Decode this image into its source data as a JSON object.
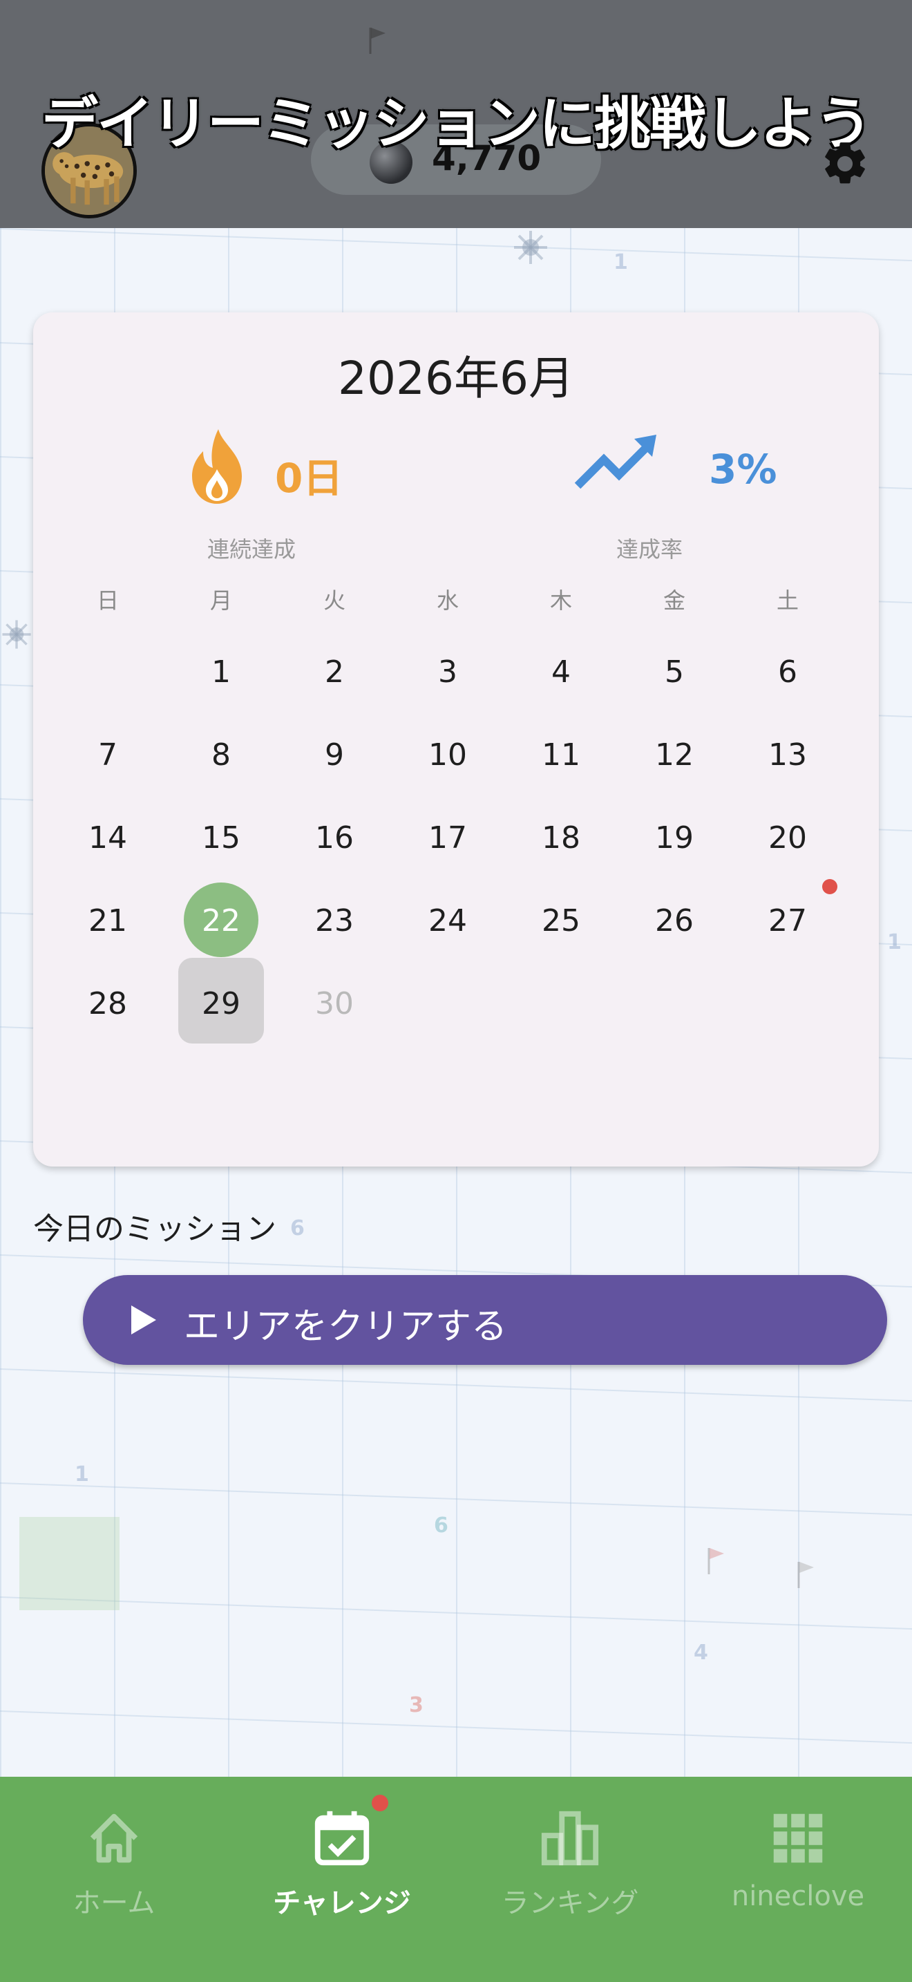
{
  "header": {
    "title": "デイリーミッションに挑戦しよう",
    "coins": "4,770",
    "avatar_icon": "leopard-avatar",
    "settings_icon": "gear-icon"
  },
  "calendar": {
    "month_title": "2026年6月",
    "streak": {
      "value": "0日",
      "label": "連続達成",
      "icon": "flame-icon",
      "color": "#f0a23a"
    },
    "rate": {
      "value": "3%",
      "label": "達成率",
      "icon": "trend-up-icon",
      "color": "#4a90d9"
    },
    "weekdays": [
      "日",
      "月",
      "火",
      "水",
      "木",
      "金",
      "土"
    ],
    "weeks": [
      [
        "",
        "1",
        "2",
        "3",
        "4",
        "5",
        "6"
      ],
      [
        "7",
        "8",
        "9",
        "10",
        "11",
        "12",
        "13"
      ],
      [
        "14",
        "15",
        "16",
        "17",
        "18",
        "19",
        "20"
      ],
      [
        "21",
        "22",
        "23",
        "24",
        "25",
        "26",
        "27"
      ],
      [
        "28",
        "29",
        "30",
        "",
        "",
        "",
        ""
      ]
    ],
    "completed_day": "22",
    "selected_day": "29",
    "disabled_day": "30",
    "marked_day": "27",
    "accent_complete": "#8cbe82"
  },
  "mission": {
    "label": "今日のミッション",
    "button_label": "エリアをクリアする",
    "button_color": "#62539f"
  },
  "nav": {
    "items": [
      {
        "label": "ホーム",
        "icon": "home-icon",
        "active": false
      },
      {
        "label": "チャレンジ",
        "icon": "calendar-check-icon",
        "active": true,
        "badge": true
      },
      {
        "label": "ランキング",
        "icon": "bar-chart-icon",
        "active": false
      },
      {
        "label": "nineclove",
        "icon": "grid-icon",
        "active": false
      }
    ],
    "color": "#67ad5b"
  },
  "background": {
    "decor_numbers": [
      "1",
      "1",
      "6",
      "1",
      "6",
      "4",
      "3"
    ]
  }
}
